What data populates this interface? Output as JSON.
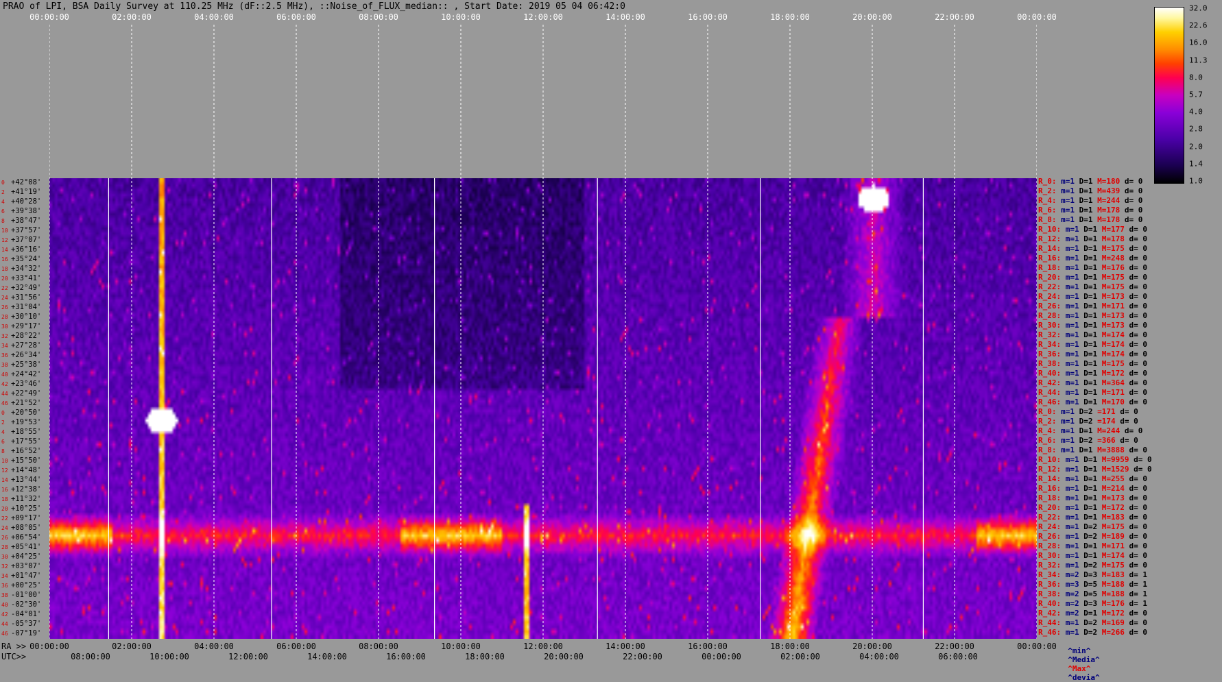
{
  "title": "PRAO of LPI, BSA Daily Survey at 110.25 MHz (dF::2.5 MHz), ::Noise_of_FLUX_median:: , Start Date: 2019 05 04 06:42:0",
  "top_axis_ticks": [
    "00:00:00",
    "02:00:00",
    "04:00:00",
    "06:00:00",
    "08:00:00",
    "10:00:00",
    "12:00:00",
    "14:00:00",
    "16:00:00",
    "18:00:00",
    "20:00:00",
    "22:00:00",
    "00:00:00"
  ],
  "bottom_axis": {
    "ra_prefix": "RA >>",
    "ra_ticks": [
      "00:00:00",
      "02:00:00",
      "04:00:00",
      "06:00:00",
      "08:00:00",
      "10:00:00",
      "12:00:00",
      "14:00:00",
      "16:00:00",
      "18:00:00",
      "20:00:00",
      "22:00:00",
      "00:00:00"
    ],
    "utc_prefix": "UTC>>",
    "utc_ticks": [
      "08:00:00",
      "10:00:00",
      "12:00:00",
      "14:00:00",
      "16:00:00",
      "18:00:00",
      "20:00:00",
      "22:00:00",
      "00:00:00",
      "02:00:00",
      "04:00:00",
      "06:00:00"
    ]
  },
  "declinations": [
    {
      "i": "0",
      "dec": "+42°08'"
    },
    {
      "i": "2",
      "dec": "+41°19'"
    },
    {
      "i": "4",
      "dec": "+40°28'"
    },
    {
      "i": "6",
      "dec": "+39°38'"
    },
    {
      "i": "8",
      "dec": "+38°47'"
    },
    {
      "i": "10",
      "dec": "+37°57'"
    },
    {
      "i": "12",
      "dec": "+37°07'"
    },
    {
      "i": "14",
      "dec": "+36°16'"
    },
    {
      "i": "16",
      "dec": "+35°24'"
    },
    {
      "i": "18",
      "dec": "+34°32'"
    },
    {
      "i": "20",
      "dec": "+33°41'"
    },
    {
      "i": "22",
      "dec": "+32°49'"
    },
    {
      "i": "24",
      "dec": "+31°56'"
    },
    {
      "i": "26",
      "dec": "+31°04'"
    },
    {
      "i": "28",
      "dec": "+30°10'"
    },
    {
      "i": "30",
      "dec": "+29°17'"
    },
    {
      "i": "32",
      "dec": "+28°22'"
    },
    {
      "i": "34",
      "dec": "+27°28'"
    },
    {
      "i": "36",
      "dec": "+26°34'"
    },
    {
      "i": "38",
      "dec": "+25°38'"
    },
    {
      "i": "40",
      "dec": "+24°42'"
    },
    {
      "i": "42",
      "dec": "+23°46'"
    },
    {
      "i": "44",
      "dec": "+22°49'"
    },
    {
      "i": "46",
      "dec": "+21°52'"
    },
    {
      "i": "0",
      "dec": "+20°50'"
    },
    {
      "i": "2",
      "dec": "+19°53'"
    },
    {
      "i": "4",
      "dec": "+18°55'"
    },
    {
      "i": "6",
      "dec": "+17°55'"
    },
    {
      "i": "8",
      "dec": "+16°52'"
    },
    {
      "i": "10",
      "dec": "+15°50'"
    },
    {
      "i": "12",
      "dec": "+14°48'"
    },
    {
      "i": "14",
      "dec": "+13°44'"
    },
    {
      "i": "16",
      "dec": "+12°38'"
    },
    {
      "i": "18",
      "dec": "+11°32'"
    },
    {
      "i": "20",
      "dec": "+10°25'"
    },
    {
      "i": "22",
      "dec": "+09°17'"
    },
    {
      "i": "24",
      "dec": "+08°05'"
    },
    {
      "i": "26",
      "dec": "+06°54'"
    },
    {
      "i": "28",
      "dec": "+05°41'"
    },
    {
      "i": "30",
      "dec": "+04°25'"
    },
    {
      "i": "32",
      "dec": "+03°07'"
    },
    {
      "i": "34",
      "dec": "+01°47'"
    },
    {
      "i": "36",
      "dec": "+00°25'"
    },
    {
      "i": "38",
      "dec": "-01°00'"
    },
    {
      "i": "40",
      "dec": "-02°30'"
    },
    {
      "i": "42",
      "dec": "-04°01'"
    },
    {
      "i": "44",
      "dec": "-05°37'"
    },
    {
      "i": "46",
      "dec": "-07°19'"
    }
  ],
  "rows": [
    {
      "r": "R_0:",
      "m": "m=1",
      "d": "D=1",
      "M": "M=180",
      "dd": "d= 0"
    },
    {
      "r": "R_2:",
      "m": "m=1",
      "d": "D=1",
      "M": "M=439",
      "dd": "d= 0"
    },
    {
      "r": "R_4:",
      "m": "m=1",
      "d": "D=1",
      "M": "M=244",
      "dd": "d= 0"
    },
    {
      "r": "R_6:",
      "m": "m=1",
      "d": "D=1",
      "M": "M=178",
      "dd": "d= 0"
    },
    {
      "r": "R_8:",
      "m": "m=1",
      "d": "D=1",
      "M": "M=178",
      "dd": "d= 0"
    },
    {
      "r": "R_10:",
      "m": "m=1",
      "d": "D=1",
      "M": "M=177",
      "dd": "d= 0"
    },
    {
      "r": "R_12:",
      "m": "m=1",
      "d": "D=1",
      "M": "M=178",
      "dd": "d= 0"
    },
    {
      "r": "R_14:",
      "m": "m=1",
      "d": "D=1",
      "M": "M=175",
      "dd": "d= 0"
    },
    {
      "r": "R_16:",
      "m": "m=1",
      "d": "D=1",
      "M": "M=248",
      "dd": "d= 0"
    },
    {
      "r": "R_18:",
      "m": "m=1",
      "d": "D=1",
      "M": "M=176",
      "dd": "d= 0"
    },
    {
      "r": "R_20:",
      "m": "m=1",
      "d": "D=1",
      "M": "M=175",
      "dd": "d= 0"
    },
    {
      "r": "R_22:",
      "m": "m=1",
      "d": "D=1",
      "M": "M=175",
      "dd": "d= 0"
    },
    {
      "r": "R_24:",
      "m": "m=1",
      "d": "D=1",
      "M": "M=173",
      "dd": "d= 0"
    },
    {
      "r": "R_26:",
      "m": "m=1",
      "d": "D=1",
      "M": "M=171",
      "dd": "d= 0"
    },
    {
      "r": "R_28:",
      "m": "m=1",
      "d": "D=1",
      "M": "M=173",
      "dd": "d= 0"
    },
    {
      "r": "R_30:",
      "m": "m=1",
      "d": "D=1",
      "M": "M=173",
      "dd": "d= 0"
    },
    {
      "r": "R_32:",
      "m": "m=1",
      "d": "D=1",
      "M": "M=174",
      "dd": "d= 0"
    },
    {
      "r": "R_34:",
      "m": "m=1",
      "d": "D=1",
      "M": "M=174",
      "dd": "d= 0"
    },
    {
      "r": "R_36:",
      "m": "m=1",
      "d": "D=1",
      "M": "M=174",
      "dd": "d= 0"
    },
    {
      "r": "R_38:",
      "m": "m=1",
      "d": "D=1",
      "M": "M=175",
      "dd": "d= 0"
    },
    {
      "r": "R_40:",
      "m": "m=1",
      "d": "D=1",
      "M": "M=172",
      "dd": "d= 0"
    },
    {
      "r": "R_42:",
      "m": "m=1",
      "d": "D=1",
      "M": "M=364",
      "dd": "d= 0"
    },
    {
      "r": "R_44:",
      "m": "m=1",
      "d": "D=1",
      "M": "M=171",
      "dd": "d= 0"
    },
    {
      "r": "R_46:",
      "m": "m=1",
      "d": "D=1",
      "M": "M=170",
      "dd": "d= 0"
    },
    {
      "r": "R_0:",
      "m": "m=1",
      "d": "D=2",
      "M": "=171",
      "dd": "d= 0"
    },
    {
      "r": "R_2:",
      "m": "m=1",
      "d": "D=2",
      "M": "=174",
      "dd": "d= 0"
    },
    {
      "r": "R_4:",
      "m": "m=1",
      "d": "D=1",
      "M": "M=244",
      "dd": "d= 0"
    },
    {
      "r": "R_6:",
      "m": "m=1",
      "d": "D=2",
      "M": "=366",
      "dd": "d= 0"
    },
    {
      "r": "R_8:",
      "m": "m=1",
      "d": "D=1",
      "M": "M=3888",
      "dd": "d= 0"
    },
    {
      "r": "R_10:",
      "m": "m=1",
      "d": "D=1",
      "M": "M=9959",
      "dd": "d= 0"
    },
    {
      "r": "R_12:",
      "m": "m=1",
      "d": "D=1",
      "M": "M=1529",
      "dd": "d= 0"
    },
    {
      "r": "R_14:",
      "m": "m=1",
      "d": "D=1",
      "M": "M=255",
      "dd": "d= 0"
    },
    {
      "r": "R_16:",
      "m": "m=1",
      "d": "D=1",
      "M": "M=214",
      "dd": "d= 0"
    },
    {
      "r": "R_18:",
      "m": "m=1",
      "d": "D=1",
      "M": "M=173",
      "dd": "d= 0"
    },
    {
      "r": "R_20:",
      "m": "m=1",
      "d": "D=1",
      "M": "M=172",
      "dd": "d= 0"
    },
    {
      "r": "R_22:",
      "m": "m=1",
      "d": "D=1",
      "M": "M=183",
      "dd": "d= 0"
    },
    {
      "r": "R_24:",
      "m": "m=1",
      "d": "D=2",
      "M": "M=175",
      "dd": "d= 0"
    },
    {
      "r": "R_26:",
      "m": "m=1",
      "d": "D=2",
      "M": "M=189",
      "dd": "d= 0"
    },
    {
      "r": "R_28:",
      "m": "m=1",
      "d": "D=1",
      "M": "M=171",
      "dd": "d= 0"
    },
    {
      "r": "R_30:",
      "m": "m=1",
      "d": "D=1",
      "M": "M=174",
      "dd": "d= 0"
    },
    {
      "r": "R_32:",
      "m": "m=1",
      "d": "D=2",
      "M": "M=175",
      "dd": "d= 0"
    },
    {
      "r": "R_34:",
      "m": "m=2",
      "d": "D=3",
      "M": "M=183",
      "dd": "d= 1"
    },
    {
      "r": "R_36:",
      "m": "m=3",
      "d": "D=5",
      "M": "M=188",
      "dd": "d= 1"
    },
    {
      "r": "R_38:",
      "m": "m=2",
      "d": "D=5",
      "M": "M=188",
      "dd": "d= 1"
    },
    {
      "r": "R_40:",
      "m": "m=2",
      "d": "D=3",
      "M": "M=176",
      "dd": "d= 1"
    },
    {
      "r": "R_42:",
      "m": "m=2",
      "d": "D=1",
      "M": "M=172",
      "dd": "d= 0"
    },
    {
      "r": "R_44:",
      "m": "m=1",
      "d": "D=2",
      "M": "M=169",
      "dd": "d= 0"
    },
    {
      "r": "R_46:",
      "m": "m=1",
      "d": "D=2",
      "M": "M=266",
      "dd": "d= 0"
    }
  ],
  "stats_header": {
    "min": "^min^",
    "media": "^Media^",
    "max": "^Max^",
    "devia": "^devia^"
  },
  "colorbar": {
    "labels": [
      "32.0",
      "22.6",
      "16.0",
      "11.3",
      "8.0",
      "5.7",
      "4.0",
      "2.8",
      "2.0",
      "1.4",
      "1.0"
    ]
  },
  "chart_data": {
    "type": "heatmap",
    "title": "PRAO of LPI, BSA Daily Survey at 110.25 MHz (dF::2.5 MHz), ::Noise_of_FLUX_median:: , Start Date: 2019 05 04 06:42:0",
    "x_axis": "RA 00:00:00 to 24:00:00",
    "y_axis": "Declination +42°08' to -07°19' (48 beams)",
    "colorscale_range": [
      1.0,
      32.0
    ],
    "features": [
      {
        "name": "bright source",
        "ra": "02:50",
        "dec": "+15°50'",
        "peak": 32.0
      },
      {
        "name": "bright source",
        "ra": "20:00",
        "dec": "+40°28'",
        "peak": 32.0
      },
      {
        "name": "galactic plane crossing",
        "ra": "18:00-20:00",
        "dec": "-07°19' to +20°50'",
        "peak": 16.0
      },
      {
        "name": "horizontal band",
        "dec": "+00°25' to -01°00'",
        "peak": 11.3
      }
    ]
  }
}
